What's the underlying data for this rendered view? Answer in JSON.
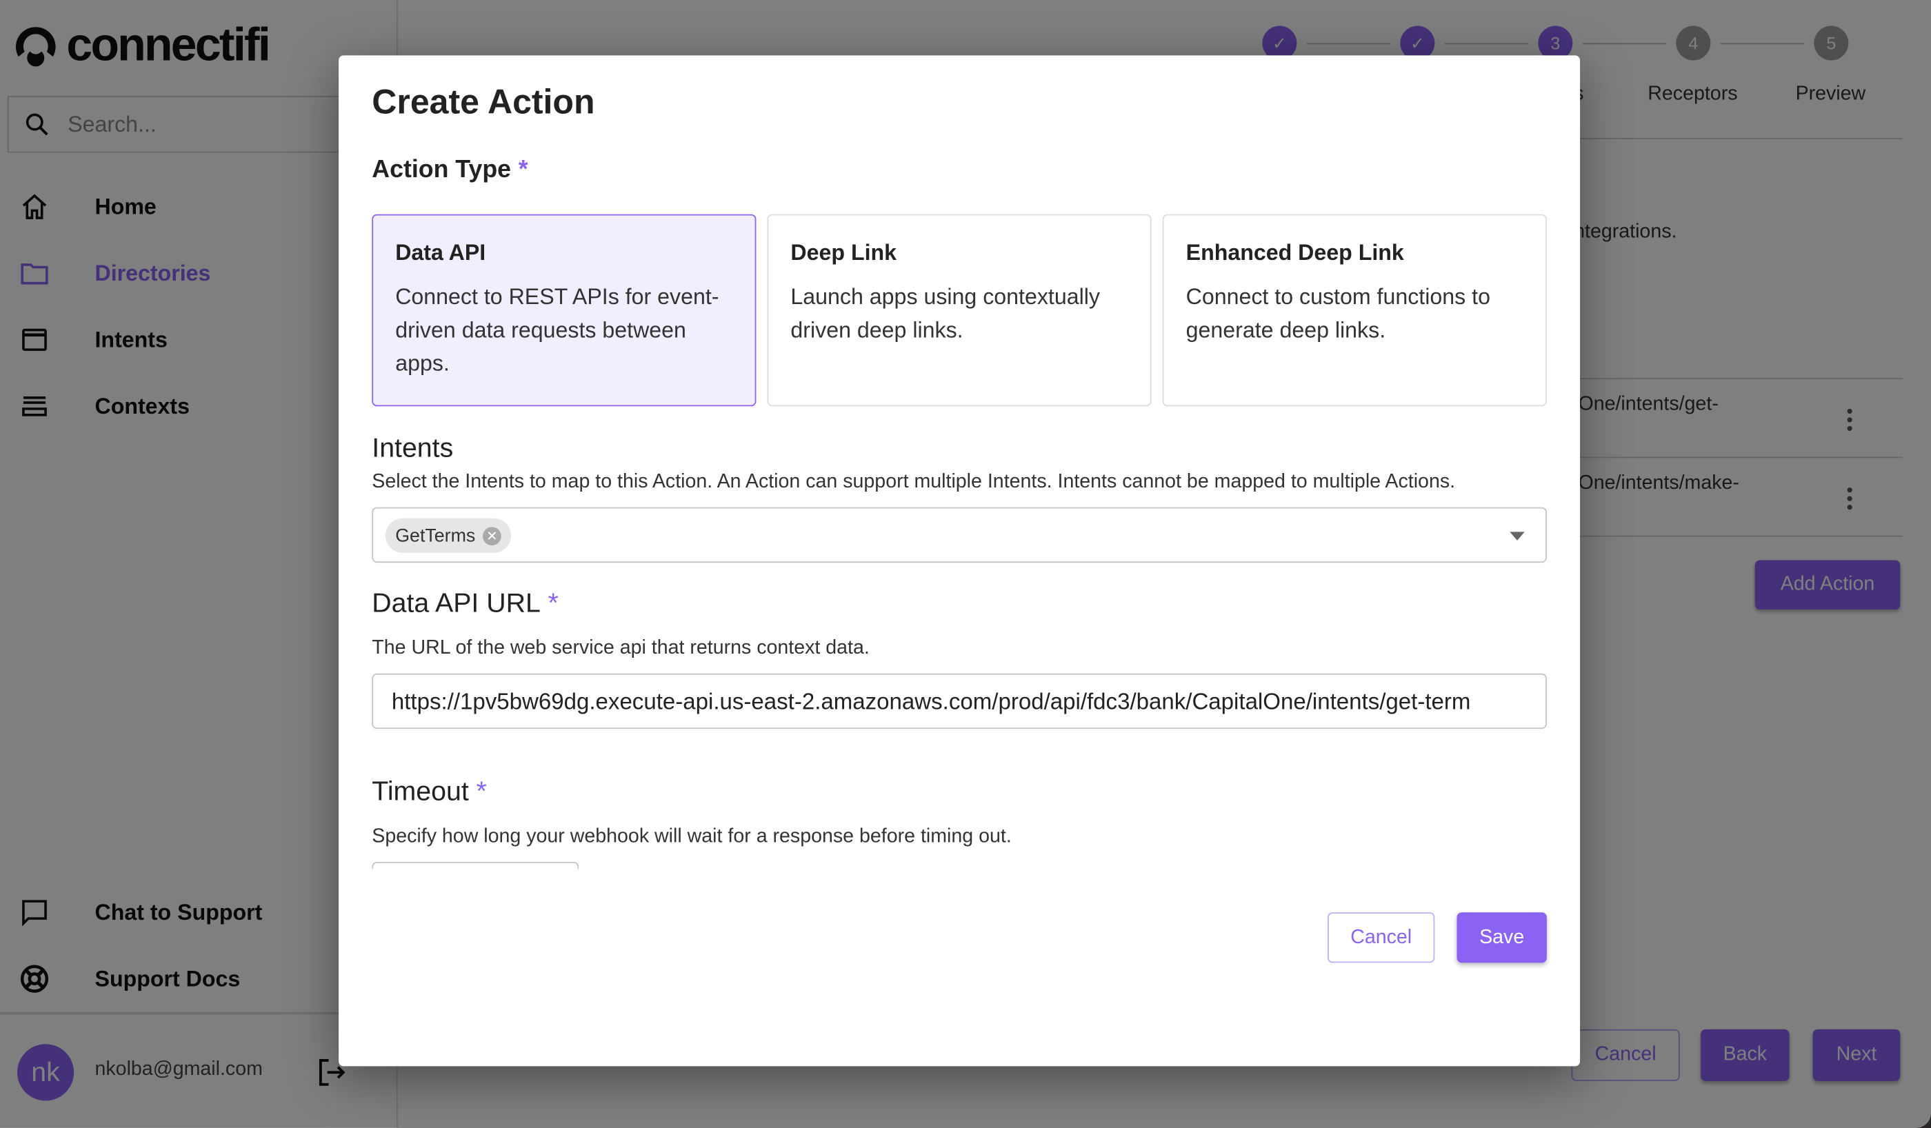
{
  "app": {
    "brand": "connectifi",
    "search_placeholder": "Search...",
    "nav": [
      {
        "label": "Home",
        "icon": "home-icon"
      },
      {
        "label": "Directories",
        "icon": "folder-icon",
        "active": true
      },
      {
        "label": "Intents",
        "icon": "window-icon"
      },
      {
        "label": "Contexts",
        "icon": "list-icon"
      }
    ],
    "support": [
      {
        "label": "Chat to Support",
        "icon": "chat-icon"
      },
      {
        "label": "Support Docs",
        "icon": "lifebuoy-icon"
      }
    ],
    "user": {
      "initials": "nk",
      "email": "nkolba@gmail.com"
    }
  },
  "wizard": {
    "steps": [
      {
        "number": "1",
        "status": "done"
      },
      {
        "number": "2",
        "status": "done"
      },
      {
        "number": "3",
        "label_partial": "s",
        "status": "current"
      },
      {
        "number": "4",
        "label": "Receptors",
        "status": "todo"
      },
      {
        "number": "5",
        "label": "Preview",
        "status": "todo"
      }
    ],
    "body_text_partial": "ntegrations.",
    "rows": [
      {
        "text_partial": "lOne/intents/get-"
      },
      {
        "text_partial": "lOne/intents/make-"
      }
    ],
    "add_action": "Add Action",
    "cancel": "Cancel",
    "back": "Back",
    "next": "Next"
  },
  "modal": {
    "title": "Create Action",
    "action_type_label": "Action Type",
    "required_mark": "*",
    "action_types": [
      {
        "title": "Data API",
        "description": "Connect to REST APIs for event-driven data requests between apps.",
        "selected": true
      },
      {
        "title": "Deep Link",
        "description": "Launch apps using contextually driven deep links.",
        "selected": false
      },
      {
        "title": "Enhanced Deep Link",
        "description": "Connect to custom functions to generate deep links.",
        "selected": false
      }
    ],
    "intents": {
      "label": "Intents",
      "description": "Select the Intents to map to this Action. An Action can support multiple Intents. Intents cannot be mapped to multiple Actions.",
      "chips": [
        "GetTerms"
      ]
    },
    "url": {
      "label": "Data API URL",
      "description": "The URL of the web service api that returns context data.",
      "value": "https://1pv5bw69dg.execute-api.us-east-2.amazonaws.com/prod/api/fdc3/bank/CapitalOne/intents/get-term"
    },
    "timeout": {
      "label": "Timeout",
      "description": "Specify how long your webhook will wait for a response before timing out."
    },
    "cancel": "Cancel",
    "save": "Save"
  },
  "colors": {
    "accent": "#8a63f5",
    "selected_bg": "#f2eefe"
  }
}
